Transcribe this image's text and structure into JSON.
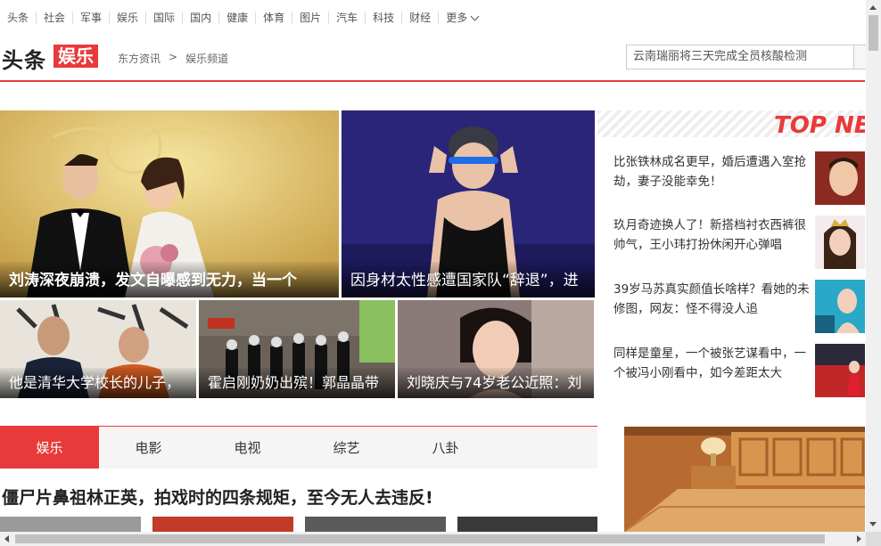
{
  "topnav": {
    "items": [
      "头条",
      "社会",
      "军事",
      "娱乐",
      "国际",
      "国内",
      "健康",
      "体育",
      "图片",
      "汽车",
      "科技",
      "财经"
    ],
    "more": "更多"
  },
  "header": {
    "logo_main": "头条",
    "logo_box": "娱乐",
    "crumb": [
      "东方资讯",
      ">",
      "娱乐频道"
    ],
    "search_value": "云南瑞丽将三天完成全员核酸检测"
  },
  "tiles": [
    "刘涛深夜崩溃，发文自曝感到无力，当一个",
    "因身材太性感遭国家队“辞退”，进",
    "他是清华大学校长的儿子，",
    "霍启刚奶奶出殡！郭晶晶带",
    "刘晓庆与74岁老公近照：刘"
  ],
  "topnews": {
    "title": "TOP NEWS",
    "items": [
      "比张铁林成名更早，婚后遭遇入室抢劫，妻子没能幸免！",
      "玖月奇迹换人了！新搭档衬衣西裤很帅气，王小玮打扮休闲开心弹唱",
      "39岁马苏真实颜值长啥样？看她的未修图，网友：怪不得没人追",
      "同样是童星，一个被张艺谋看中，一个被冯小刚看中，如今差距太大"
    ]
  },
  "tabs": [
    "娱乐",
    "电影",
    "电视",
    "综艺",
    "八卦"
  ],
  "article_title": "僵尸片鼻祖林正英，拍戏时的四条规矩，至今无人去违反!",
  "colors": {
    "accent": "#e83a3a"
  }
}
